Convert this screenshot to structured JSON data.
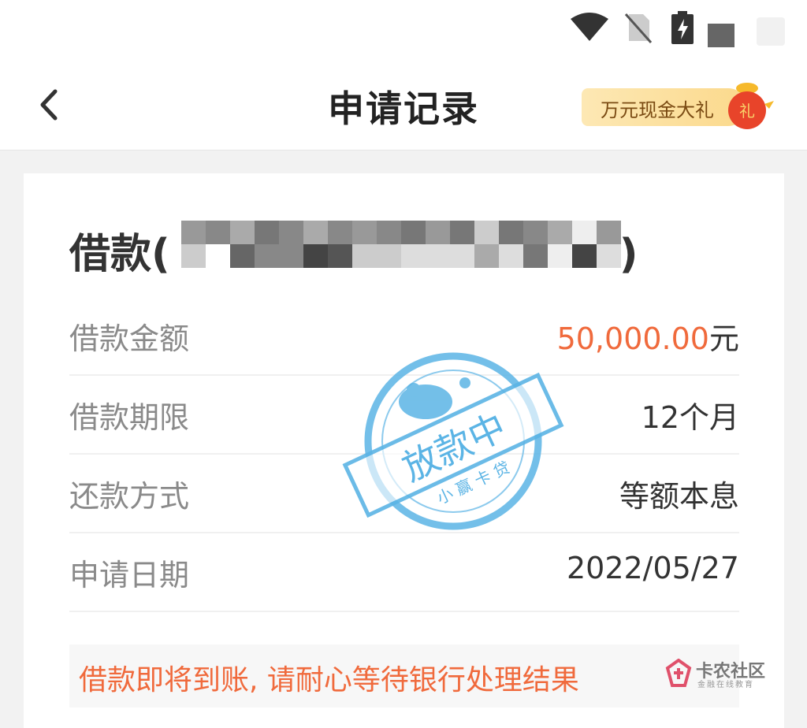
{
  "header": {
    "title": "申请记录",
    "promo_label": "万元现金大礼",
    "promo_badge": "礼"
  },
  "loan": {
    "title": "借款(",
    "title_close": ")",
    "rows": [
      {
        "label": "借款金额",
        "value": "50,000.00",
        "unit": "元"
      },
      {
        "label": "借款期限",
        "value": "12个月"
      },
      {
        "label": "还款方式",
        "value": "等额本息"
      },
      {
        "label": "申请日期",
        "value": "2022/05/27"
      }
    ],
    "notice": "借款即将到账, 请耐心等待银行处理结果"
  },
  "stamp": {
    "main": "放款中",
    "brand": "小 赢 卡 贷"
  },
  "watermark": {
    "name": "卡农社区",
    "sub": "金融在线教育"
  },
  "colors": {
    "accent": "#f06a3c",
    "stamp": "#5bb4e5"
  }
}
